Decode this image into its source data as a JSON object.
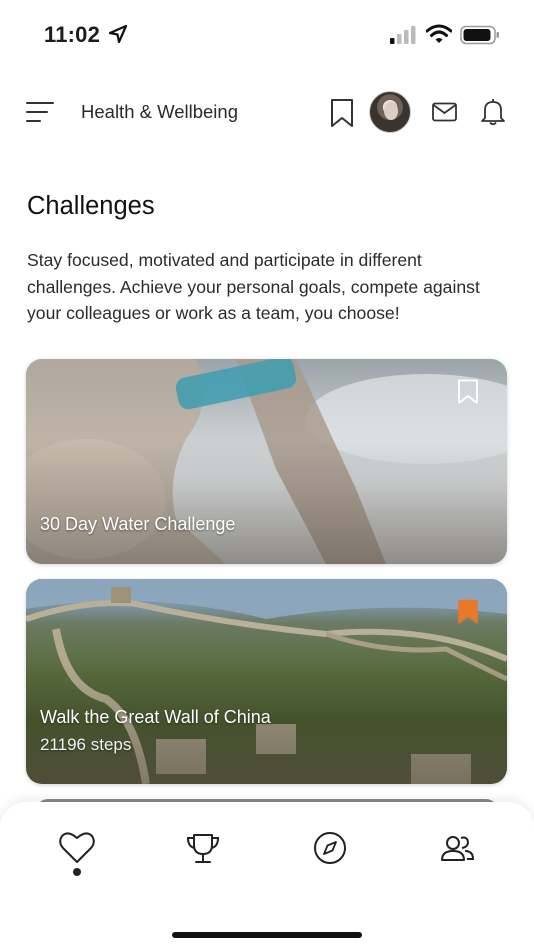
{
  "status_bar": {
    "time": "11:02",
    "icons": [
      "location-arrow-icon",
      "signal-icon",
      "wifi-icon",
      "battery-icon"
    ]
  },
  "header": {
    "title": "Health & Wellbeing",
    "icons": [
      "menu-icon",
      "bookmark-icon",
      "avatar",
      "mail-icon",
      "bell-icon"
    ]
  },
  "intro": {
    "title": "Challenges",
    "description": "Stay focused, motivated and participate in different challenges. Achieve your personal goals, compete against your colleagues or work as a team, you choose!"
  },
  "challenges": [
    {
      "title": "30 Day Water Challenge",
      "subtitle": "",
      "bookmarked": false
    },
    {
      "title": "Walk the Great Wall of China",
      "subtitle": "21196 steps",
      "bookmarked": true
    }
  ],
  "tab_bar": {
    "tabs": [
      "heart-icon",
      "trophy-icon",
      "compass-icon",
      "people-icon"
    ],
    "active_tab": "heart-icon"
  },
  "colors": {
    "accent": "#e8782a",
    "text": "#1c1c1c",
    "background": "#ffffff"
  }
}
